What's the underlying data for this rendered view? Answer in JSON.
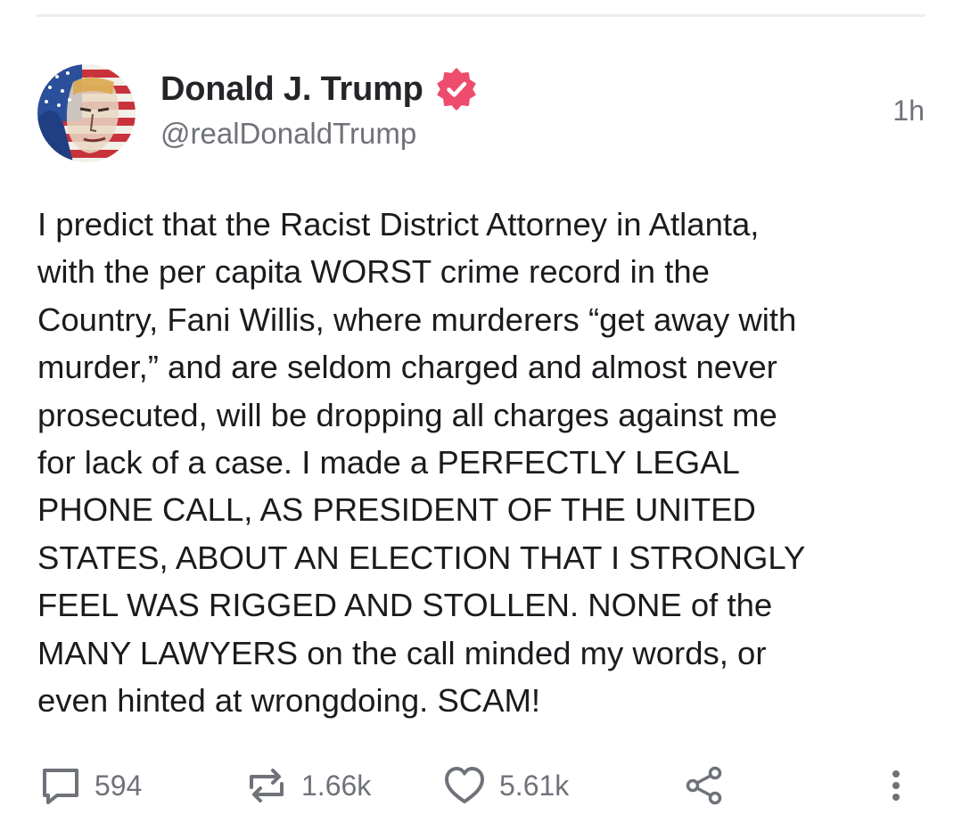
{
  "post": {
    "author": {
      "display_name": "Donald J. Trump",
      "handle": "@realDonaldTrump",
      "verified_icon": "verified-badge-icon",
      "avatar_icon": "avatar-image"
    },
    "timestamp": "1h",
    "body": "I predict that the Racist District Attorney in Atlanta,\nwith the per capita WORST crime record in the\nCountry, Fani Willis, where murderers “get away with\nmurder,” and are seldom charged and almost never\nprosecuted, will be dropping all charges against me\nfor lack of a case. I made a PERFECTLY LEGAL\nPHONE CALL, AS PRESIDENT OF THE UNITED\nSTATES, ABOUT AN ELECTION THAT I STRONGLY\nFEEL WAS RIGGED AND STOLLEN. NONE of the\nMANY LAWYERS on the call minded my words, or\neven hinted at wrongdoing. SCAM!"
  },
  "actions": {
    "reply": {
      "icon": "reply-icon",
      "count": "594"
    },
    "repost": {
      "icon": "repost-icon",
      "count": "1.66k"
    },
    "like": {
      "icon": "heart-icon",
      "count": "5.61k"
    },
    "share": {
      "icon": "share-icon"
    },
    "more": {
      "icon": "more-vertical-icon"
    }
  },
  "colors": {
    "verified_badge": "#ee4c6d",
    "text_primary": "#1b1b1f",
    "text_secondary": "#6f7279",
    "icon": "#6f7279",
    "divider": "#eceef1"
  }
}
